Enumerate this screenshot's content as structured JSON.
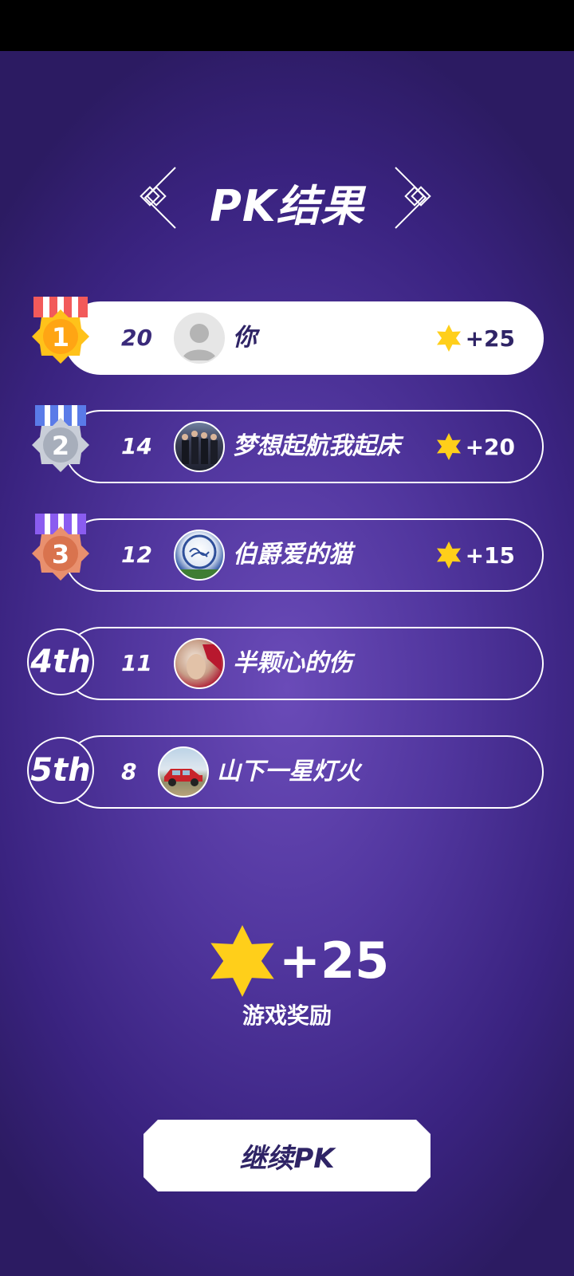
{
  "title": "PK结果",
  "colors": {
    "background": "#4a2f95",
    "gold": "#ffcf1a",
    "dark_text": "#2f2466"
  },
  "players": [
    {
      "rank": 1,
      "score": "20",
      "name": "你",
      "reward": "+25",
      "is_me": true,
      "avatar": "default-avatar-icon"
    },
    {
      "rank": 2,
      "score": "14",
      "name": "梦想起航我起床",
      "reward": "+20",
      "is_me": false,
      "avatar": "group-photo-avatar"
    },
    {
      "rank": 3,
      "score": "12",
      "name": "伯爵爱的猫",
      "reward": "+15",
      "is_me": false,
      "avatar": "calligraphy-avatar"
    },
    {
      "rank": 4,
      "rank_label": "4th",
      "score": "11",
      "name": "半颗心的伤",
      "is_me": false,
      "avatar": "photo-avatar"
    },
    {
      "rank": 5,
      "rank_label": "5th",
      "score": "8",
      "name": "山下一星灯火",
      "is_me": false,
      "avatar": "car-photo-avatar"
    }
  ],
  "bonus": {
    "value": "+25",
    "label": "游戏奖励"
  },
  "continue_button": "继续PK"
}
